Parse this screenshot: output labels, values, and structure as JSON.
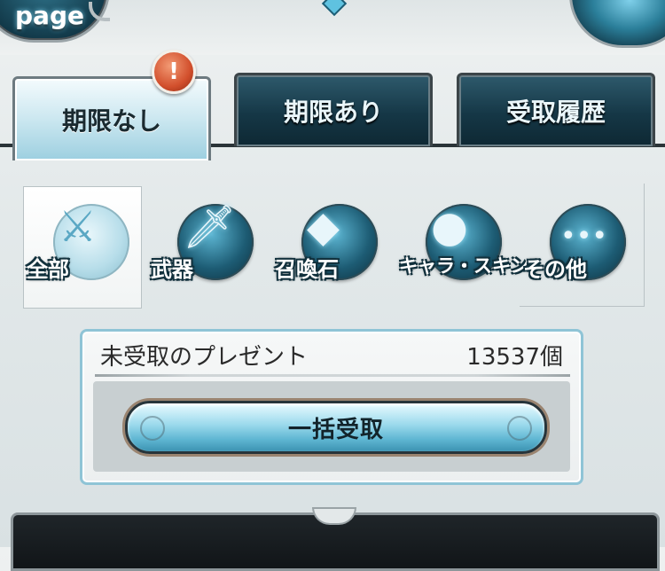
{
  "header": {
    "page_label": "page"
  },
  "tabs": [
    {
      "label": "期限なし",
      "active": true,
      "badge": "!"
    },
    {
      "label": "期限あり",
      "active": false
    },
    {
      "label": "受取履歴",
      "active": false
    }
  ],
  "categories": [
    {
      "label": "全部",
      "icon": "all-items-icon",
      "selected": true
    },
    {
      "label": "武器",
      "icon": "sword-icon",
      "selected": false
    },
    {
      "label": "召喚石",
      "icon": "crystal-icon",
      "selected": false
    },
    {
      "label": "キャラ・スキン",
      "icon": "character-icon",
      "selected": false
    },
    {
      "label": "その他",
      "icon": "more-dots-icon",
      "selected": false
    }
  ],
  "present_panel": {
    "label": "未受取のプレゼント",
    "count": "13537個",
    "collect_all_button": "一括受取"
  },
  "colors": {
    "tab_dark": "#153746",
    "tab_active": "#cbe7f0",
    "accent_blue": "#5fb6d2",
    "badge_red": "#d24f2c"
  }
}
